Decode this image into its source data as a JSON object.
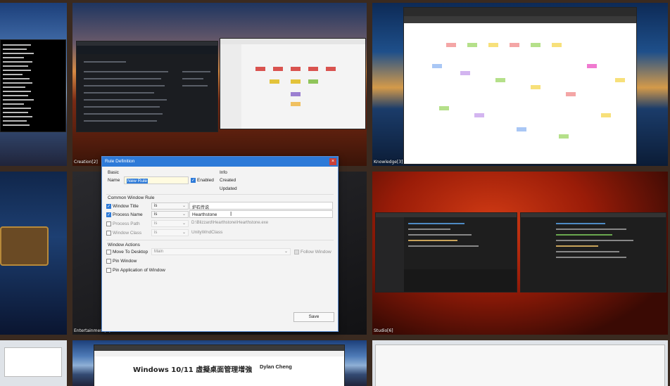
{
  "desktops": {
    "creation": "Creation[2]",
    "knowledge": "Knowledge[3]",
    "entertainment": "Entertainment[4]",
    "studio": "Studio[6]"
  },
  "browser_page": {
    "title": "Windows 10/11 虛擬桌面管理增強",
    "author": "Dylan Cheng"
  },
  "dialog": {
    "title": "Rule Definition",
    "close": "×",
    "basic": {
      "heading": "Basic",
      "name_label": "Name",
      "name_value": "New Rule",
      "enabled_label": "Enabled",
      "enabled": true
    },
    "info": {
      "heading": "Info",
      "created": "Created",
      "updated": "Updated"
    },
    "common": {
      "heading": "Common Window Rule",
      "rows": [
        {
          "label": "Window Title",
          "checked": true,
          "op": "is",
          "value": "炉石传说"
        },
        {
          "label": "Process Name",
          "checked": true,
          "op": "is",
          "value": "Hearthstone"
        },
        {
          "label": "Process Path",
          "checked": false,
          "op": "is",
          "value": "D:\\Blizzard\\Hearthstone\\Hearthstone.exe"
        },
        {
          "label": "Window Class",
          "checked": false,
          "op": "is",
          "value": "UnityWndClass"
        }
      ]
    },
    "actions": {
      "heading": "Window Actions",
      "move_label": "Move To Desktop",
      "move_value": "Main",
      "follow_label": "Follow Window",
      "pin_window": "Pin Window",
      "pin_app": "Pin Application of Window"
    },
    "save": "Save",
    "colors": {
      "accent": "#2d7ad8",
      "close": "#c9403a"
    }
  }
}
